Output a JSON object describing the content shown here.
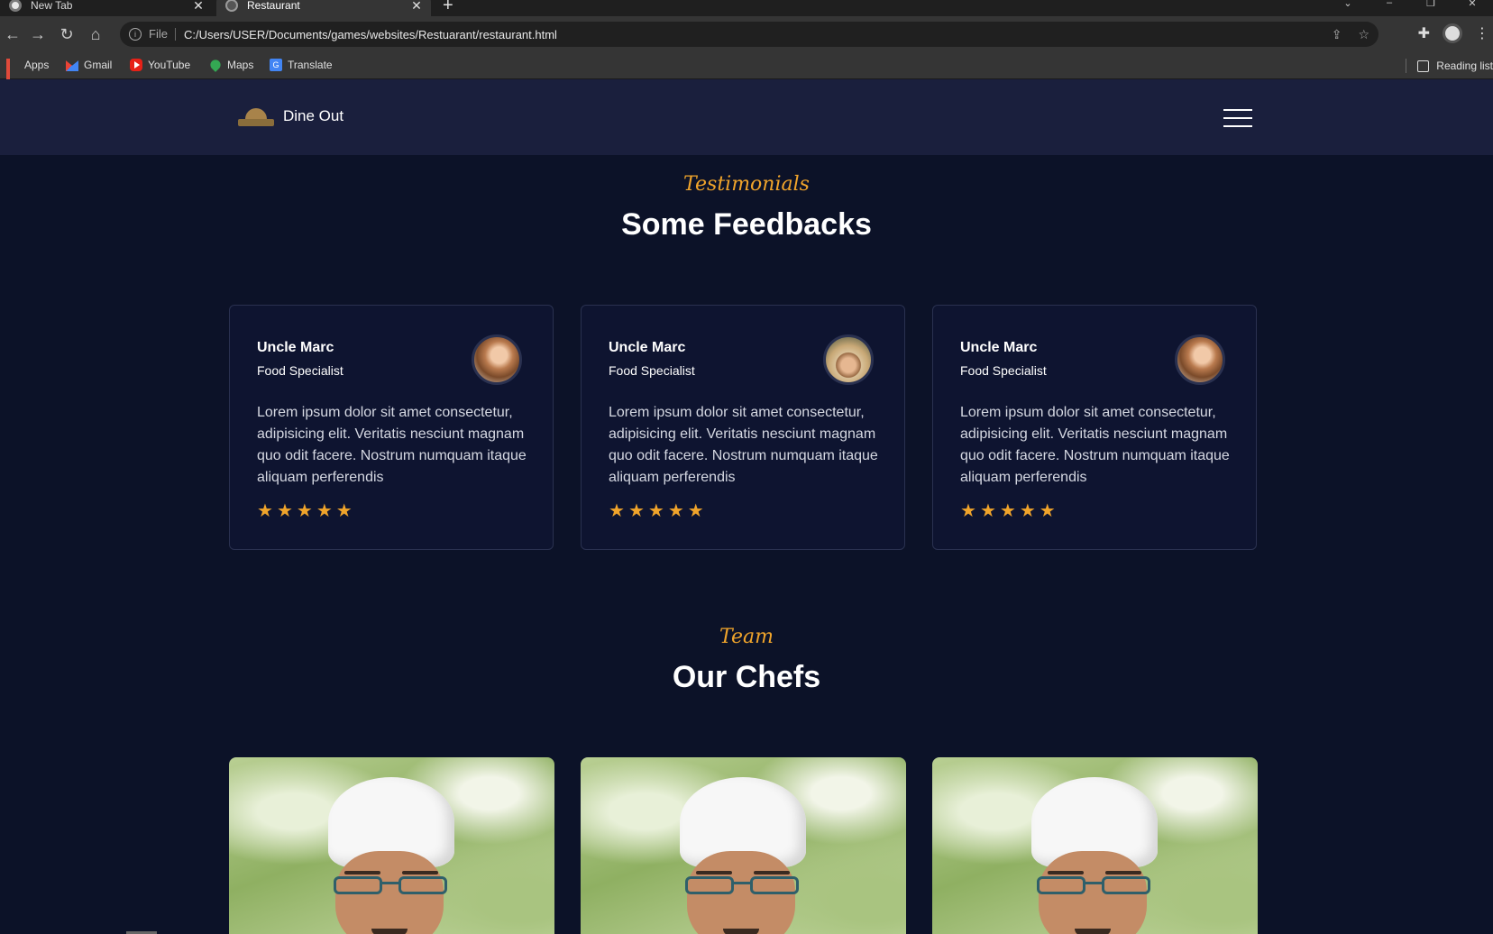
{
  "browser": {
    "tabs": [
      {
        "title": "New Tab",
        "active": false
      },
      {
        "title": "Restaurant",
        "active": true
      }
    ],
    "new_tab_symbol": "+",
    "address": {
      "scheme_label": "File",
      "url": "C:/Users/USER/Documents/games/websites/Restuarant/restaurant.html"
    },
    "bookmarks": [
      {
        "label": "Apps",
        "icon": "apps-grid-icon"
      },
      {
        "label": "Gmail",
        "icon": "gmail-icon"
      },
      {
        "label": "YouTube",
        "icon": "youtube-icon"
      },
      {
        "label": "Maps",
        "icon": "maps-icon"
      },
      {
        "label": "Translate",
        "icon": "translate-icon"
      }
    ],
    "reading_list": "Reading list"
  },
  "site": {
    "brand": "Dine Out",
    "testimonials": {
      "tag": "Testimonials",
      "title": "Some Feedbacks",
      "cards": [
        {
          "name": "Uncle Marc",
          "role": "Food Specialist",
          "text": "Lorem ipsum dolor sit amet consectetur, adipisicing elit. Veritatis nesciunt magnam quo odit facere. Nostrum numquam itaque aliquam perferendis",
          "rating": 5
        },
        {
          "name": "Uncle Marc",
          "role": "Food Specialist",
          "text": "Lorem ipsum dolor sit amet consectetur, adipisicing elit. Veritatis nesciunt magnam quo odit facere. Nostrum numquam itaque aliquam perferendis",
          "rating": 5
        },
        {
          "name": "Uncle Marc",
          "role": "Food Specialist",
          "text": "Lorem ipsum dolor sit amet consectetur, adipisicing elit. Veritatis nesciunt magnam quo odit facere. Nostrum numquam itaque aliquam perferendis",
          "rating": 5
        }
      ]
    },
    "team": {
      "tag": "Team",
      "title": "Our Chefs"
    }
  },
  "colors": {
    "accent": "#f0a42b",
    "page_bg": "#0c1228",
    "header_bg": "#1a1f3d"
  }
}
